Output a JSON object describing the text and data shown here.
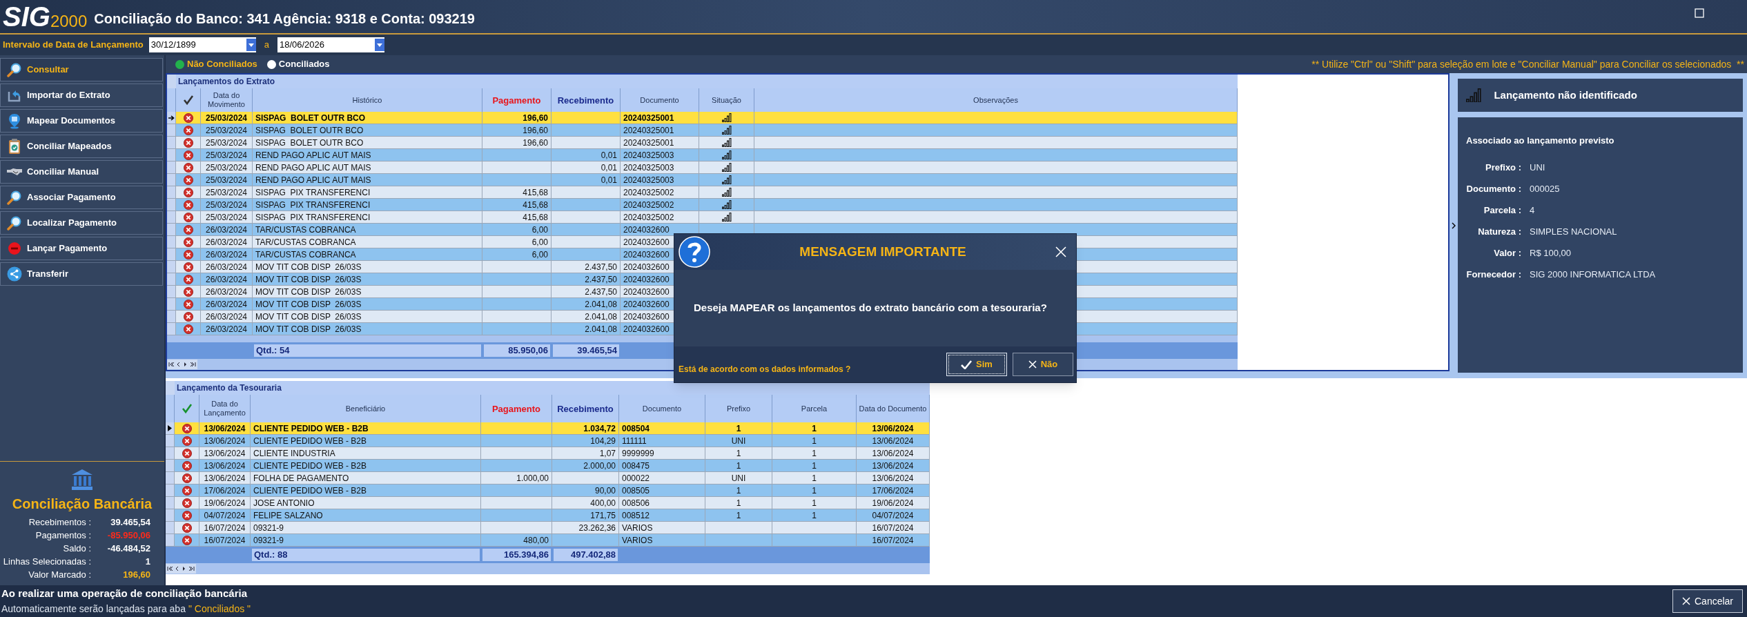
{
  "app": {
    "logo_main": "SIG",
    "logo_sub": "2000",
    "title": "Conciliação do Banco: 341 Agência: 9318 e Conta: 093219"
  },
  "date_range": {
    "label": "Intervalo de Data de Lançamento",
    "from": "30/12/1899",
    "separator": "a",
    "to": "18/06/2026"
  },
  "sidebar": {
    "items": [
      {
        "label": "Consultar",
        "selected": true
      },
      {
        "label": "Importar do Extrato",
        "selected": false
      },
      {
        "label": "Mapear Documentos",
        "selected": false
      },
      {
        "label": "Conciliar Mapeados",
        "selected": false
      },
      {
        "label": "Conciliar Manual",
        "selected": false
      },
      {
        "label": "Associar Pagamento",
        "selected": false
      },
      {
        "label": "Localizar Pagamento",
        "selected": false
      },
      {
        "label": "Lançar Pagamento",
        "selected": false
      },
      {
        "label": "Transferir",
        "selected": false
      }
    ]
  },
  "summary": {
    "title": "Conciliação Bancária",
    "rows": [
      {
        "label": "Recebimentos :",
        "value": "39.465,54",
        "kind": "normal"
      },
      {
        "label": "Pagamentos :",
        "value": "-85.950,06",
        "kind": "negative"
      },
      {
        "label": "Saldo :",
        "value": "-46.484,52",
        "kind": "normal"
      },
      {
        "label": "Linhas Selecionadas :",
        "value": "1",
        "kind": "normal"
      },
      {
        "label": "Valor Marcado :",
        "value": "196,60",
        "kind": "highlight"
      }
    ]
  },
  "filters": [
    {
      "label": "Não Conciliados",
      "selected": true,
      "color": "#22b14c"
    },
    {
      "label": "Conciliados",
      "selected": false,
      "color": "#ffffff"
    }
  ],
  "hint": "** Utilize \"Ctrl\" ou \"Shift\" para seleção em lote e \"Conciliar Manual\" para Conciliar os selecionados  **",
  "statement_grid": {
    "title": "Lançamentos do Extrato",
    "columns": [
      {
        "label": "Data do Movimento",
        "kind": "plain"
      },
      {
        "label": "Histórico",
        "kind": "plain"
      },
      {
        "label": "Pagamento",
        "kind": "payment"
      },
      {
        "label": "Recebimento",
        "kind": "receipt"
      },
      {
        "label": "Documento",
        "kind": "plain"
      },
      {
        "label": "Situação",
        "kind": "plain"
      },
      {
        "label": "Observações",
        "kind": "plain"
      }
    ],
    "rows": [
      {
        "date": "25/03/2024",
        "history": "SISPAG  BOLET OUTR BCO",
        "payment": "196,60",
        "document": "20240325001",
        "situacao_icon": true,
        "selected": true
      },
      {
        "date": "25/03/2024",
        "history": "SISPAG  BOLET OUTR BCO",
        "payment": "196,60",
        "document": "20240325001",
        "situacao_icon": true,
        "selected": false
      },
      {
        "date": "25/03/2024",
        "history": "SISPAG  BOLET OUTR BCO",
        "payment": "196,60",
        "document": "20240325001",
        "situacao_icon": true,
        "selected": false
      },
      {
        "date": "25/03/2024",
        "history": "REND PAGO APLIC AUT MAIS",
        "receipt": "0,01",
        "document": "20240325003",
        "situacao_icon": true,
        "selected": false
      },
      {
        "date": "25/03/2024",
        "history": "REND PAGO APLIC AUT MAIS",
        "receipt": "0,01",
        "document": "20240325003",
        "situacao_icon": true,
        "selected": false
      },
      {
        "date": "25/03/2024",
        "history": "REND PAGO APLIC AUT MAIS",
        "receipt": "0,01",
        "document": "20240325003",
        "situacao_icon": true,
        "selected": false
      },
      {
        "date": "25/03/2024",
        "history": "SISPAG  PIX TRANSFERENCI",
        "payment": "415,68",
        "document": "20240325002",
        "situacao_icon": true,
        "selected": false
      },
      {
        "date": "25/03/2024",
        "history": "SISPAG  PIX TRANSFERENCI",
        "payment": "415,68",
        "document": "20240325002",
        "situacao_icon": true,
        "selected": false
      },
      {
        "date": "25/03/2024",
        "history": "SISPAG  PIX TRANSFERENCI",
        "payment": "415,68",
        "document": "20240325002",
        "situacao_icon": true,
        "selected": false
      },
      {
        "date": "26/03/2024",
        "history": "TAR/CUSTAS COBRANCA",
        "payment": "6,00",
        "document": "2024032600",
        "situacao_icon": false,
        "selected": false
      },
      {
        "date": "26/03/2024",
        "history": "TAR/CUSTAS COBRANCA",
        "payment": "6,00",
        "document": "2024032600",
        "situacao_icon": false,
        "selected": false
      },
      {
        "date": "26/03/2024",
        "history": "TAR/CUSTAS COBRANCA",
        "payment": "6,00",
        "document": "2024032600",
        "situacao_icon": false,
        "selected": false
      },
      {
        "date": "26/03/2024",
        "history": "MOV TIT COB DISP  26/03S",
        "receipt": "2.437,50",
        "document": "2024032600",
        "situacao_icon": false,
        "selected": false
      },
      {
        "date": "26/03/2024",
        "history": "MOV TIT COB DISP  26/03S",
        "receipt": "2.437,50",
        "document": "2024032600",
        "situacao_icon": false,
        "selected": false
      },
      {
        "date": "26/03/2024",
        "history": "MOV TIT COB DISP  26/03S",
        "receipt": "2.437,50",
        "document": "2024032600",
        "situacao_icon": false,
        "selected": false
      },
      {
        "date": "26/03/2024",
        "history": "MOV TIT COB DISP  26/03S",
        "receipt": "2.041,08",
        "document": "2024032600",
        "situacao_icon": false,
        "selected": false
      },
      {
        "date": "26/03/2024",
        "history": "MOV TIT COB DISP  26/03S",
        "receipt": "2.041,08",
        "document": "2024032600",
        "situacao_icon": false,
        "selected": false
      },
      {
        "date": "26/03/2024",
        "history": "MOV TIT COB DISP  26/03S",
        "receipt": "2.041,08",
        "document": "2024032600",
        "situacao_icon": false,
        "selected": false
      }
    ],
    "footer": {
      "count": "Qtd.: 54",
      "payment": "85.950,06",
      "receipt": "39.465,54"
    }
  },
  "dialog": {
    "title": "MENSAGEM IMPORTANTE",
    "message": "Deseja MAPEAR os lançamentos do extrato bancário com a tesouraria?",
    "question": "Está de acordo com os dados informados ?",
    "buttons": [
      {
        "label": "Sim",
        "kind": "confirm",
        "focused": true
      },
      {
        "label": "Não",
        "kind": "cancel",
        "focused": false
      }
    ]
  },
  "detail_panel": {
    "status": "Lançamento não identificado",
    "subtitle": "Associado ao lançamento previsto",
    "fields": [
      {
        "label": "Prefixo :",
        "value": "UNI"
      },
      {
        "label": "Documento :",
        "value": "000025"
      },
      {
        "label": "Parcela :",
        "value": "4"
      },
      {
        "label": "Natureza :",
        "value": "SIMPLES NACIONAL"
      },
      {
        "label": "Valor :",
        "value": "R$ 100,00"
      },
      {
        "label": "Fornecedor :",
        "value": "SIG 2000 INFORMATICA LTDA"
      }
    ]
  },
  "treasury_grid": {
    "title": "Lançamento da Tesouraria",
    "columns": [
      {
        "label": "Data do Lançamento",
        "kind": "plain"
      },
      {
        "label": "Beneficiário",
        "kind": "plain"
      },
      {
        "label": "Pagamento",
        "kind": "payment"
      },
      {
        "label": "Recebimento",
        "kind": "receipt"
      },
      {
        "label": "Documento",
        "kind": "plain"
      },
      {
        "label": "Prefixo",
        "kind": "plain"
      },
      {
        "label": "Parcela",
        "kind": "plain"
      },
      {
        "label": "Data do Documento",
        "kind": "plain"
      }
    ],
    "rows": [
      {
        "date": "13/06/2024",
        "beneficiary": "CLIENTE PEDIDO WEB - B2B",
        "receipt": "1.034,72",
        "document": "008504",
        "prefix": "1",
        "installment": "1",
        "doc_date": "13/06/2024",
        "selected": true
      },
      {
        "date": "13/06/2024",
        "beneficiary": "CLIENTE PEDIDO WEB - B2B",
        "receipt": "104,29",
        "document": "111111",
        "prefix": "UNI",
        "installment": "1",
        "doc_date": "13/06/2024",
        "selected": false
      },
      {
        "date": "13/06/2024",
        "beneficiary": "CLIENTE INDUSTRIA",
        "receipt": "1,07",
        "document": "9999999",
        "prefix": "1",
        "installment": "1",
        "doc_date": "13/06/2024",
        "selected": false
      },
      {
        "date": "13/06/2024",
        "beneficiary": "CLIENTE PEDIDO WEB - B2B",
        "receipt": "2.000,00",
        "document": "008475",
        "prefix": "1",
        "installment": "1",
        "doc_date": "13/06/2024",
        "selected": false
      },
      {
        "date": "13/06/2024",
        "beneficiary": "FOLHA DE PAGAMENTO",
        "payment": "1.000,00",
        "document": "000022",
        "prefix": "UNI",
        "installment": "1",
        "doc_date": "13/06/2024",
        "selected": false
      },
      {
        "date": "17/06/2024",
        "beneficiary": "CLIENTE PEDIDO WEB - B2B",
        "receipt": "90,00",
        "document": "008505",
        "prefix": "1",
        "installment": "1",
        "doc_date": "17/06/2024",
        "selected": false
      },
      {
        "date": "19/06/2024",
        "beneficiary": "JOSE ANTONIO",
        "receipt": "400,00",
        "document": "008506",
        "prefix": "1",
        "installment": "1",
        "doc_date": "19/06/2024",
        "selected": false
      },
      {
        "date": "04/07/2024",
        "beneficiary": "FELIPE SALZANO",
        "receipt": "171,75",
        "document": "008512",
        "prefix": "1",
        "installment": "1",
        "doc_date": "04/07/2024",
        "selected": false
      },
      {
        "date": "16/07/2024",
        "beneficiary": "09321-9",
        "receipt": "23.262,36",
        "document": "VARIOS",
        "doc_date": "16/07/2024",
        "selected": false
      },
      {
        "date": "16/07/2024",
        "beneficiary": "09321-9",
        "payment": "480,00",
        "document": "VARIOS",
        "doc_date": "16/07/2024",
        "selected": false
      }
    ],
    "footer": {
      "count": "Qtd.: 88",
      "payment": "165.394,86",
      "receipt": "497.402,88"
    }
  },
  "bottom_bar": {
    "line1": "Ao realizar uma operação de conciliação bancária",
    "line2": "Automaticamente serão lançadas para aba",
    "highlight": "\" Conciliados \"",
    "cancel": "Cancelar"
  }
}
